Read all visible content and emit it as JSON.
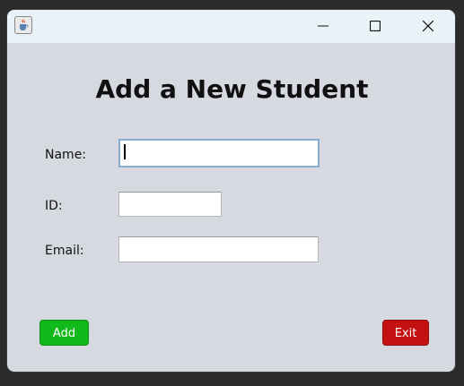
{
  "window": {
    "heading": "Add a New Student"
  },
  "form": {
    "name_label": "Name:",
    "name_value": "",
    "id_label": "ID:",
    "id_value": "",
    "email_label": "Email:",
    "email_value": ""
  },
  "buttons": {
    "add_label": "Add",
    "exit_label": "Exit"
  },
  "colors": {
    "add_button": "#12b91b",
    "exit_button": "#c41213",
    "window_background": "#d6d9e0",
    "titlebar_background": "#e9f3f7"
  },
  "icons": {
    "app": "java-cup-icon",
    "minimize": "minimize-icon",
    "maximize": "maximize-icon",
    "close": "close-icon"
  }
}
